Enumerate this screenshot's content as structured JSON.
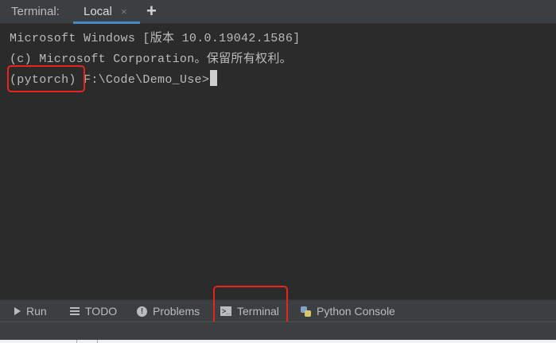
{
  "tabs": {
    "prefix": "Terminal:",
    "active": "Local",
    "close_glyph": "×",
    "add_glyph": "+"
  },
  "terminal": {
    "lines": [
      "Microsoft Windows [版本 10.0.19042.1586]",
      "(c) Microsoft Corporation。保留所有权利。"
    ],
    "prompt_env": "(pytorch)",
    "prompt_path": " F:\\Code\\Demo_Use>"
  },
  "toolwindows": {
    "run": "Run",
    "todo": "TODO",
    "problems": "Problems",
    "problems_glyph": "!",
    "terminal": "Terminal",
    "terminal_glyph": ">_",
    "python_console": "Python Console"
  },
  "colors": {
    "highlight": "#e8251b",
    "active_tab_underline": "#4a88c7"
  }
}
